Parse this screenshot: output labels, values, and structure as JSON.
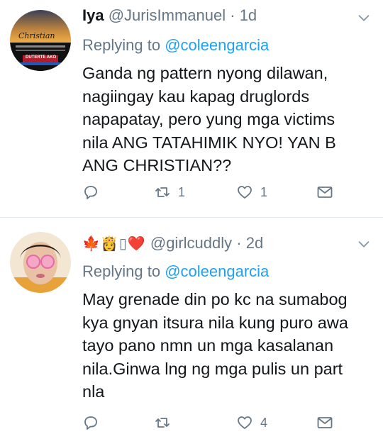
{
  "tweets": [
    {
      "display_name": "Iya",
      "handle": "@JurisImmanuel",
      "separator": "·",
      "time": "1d",
      "replying_prefix": "Replying to",
      "replying_to": "@coleengarcia",
      "body_lines": [
        "Ganda ng pattern nyong dilawan,",
        "nagiingay kau kapag druglords",
        "napapatay, pero yung mga victims",
        "nila ANG TATAHIMIK NYO! YAN B",
        "ANG CHRISTIAN??"
      ],
      "reply_count": "",
      "retweet_count": "1",
      "like_count": "1",
      "avatar_text": {
        "top": "Christian",
        "bottom": "DUTERTE AKO"
      }
    },
    {
      "display_name_emoji": [
        "🍁",
        "👸",
        "▯",
        "❤️"
      ],
      "handle": "@girlcuddly",
      "separator": "·",
      "time": "2d",
      "replying_prefix": "Replying to",
      "replying_to": "@coleengarcia",
      "body_lines": [
        "May grenade din po kc na sumabog",
        "kya gnyan itsura nila kung puro awa",
        "tayo pano nmn un mga kasalanan",
        "nila.Ginwa lng ng  mga pulis un part",
        "nla"
      ],
      "reply_count": "",
      "retweet_count": "",
      "like_count": "4"
    }
  ],
  "colors": {
    "link": "#1da1f2",
    "secondary_text": "#657786",
    "divider": "#e1e8ed"
  },
  "icons": [
    "reply-icon",
    "retweet-icon",
    "like-icon",
    "direct-message-icon",
    "chevron-down-icon"
  ]
}
